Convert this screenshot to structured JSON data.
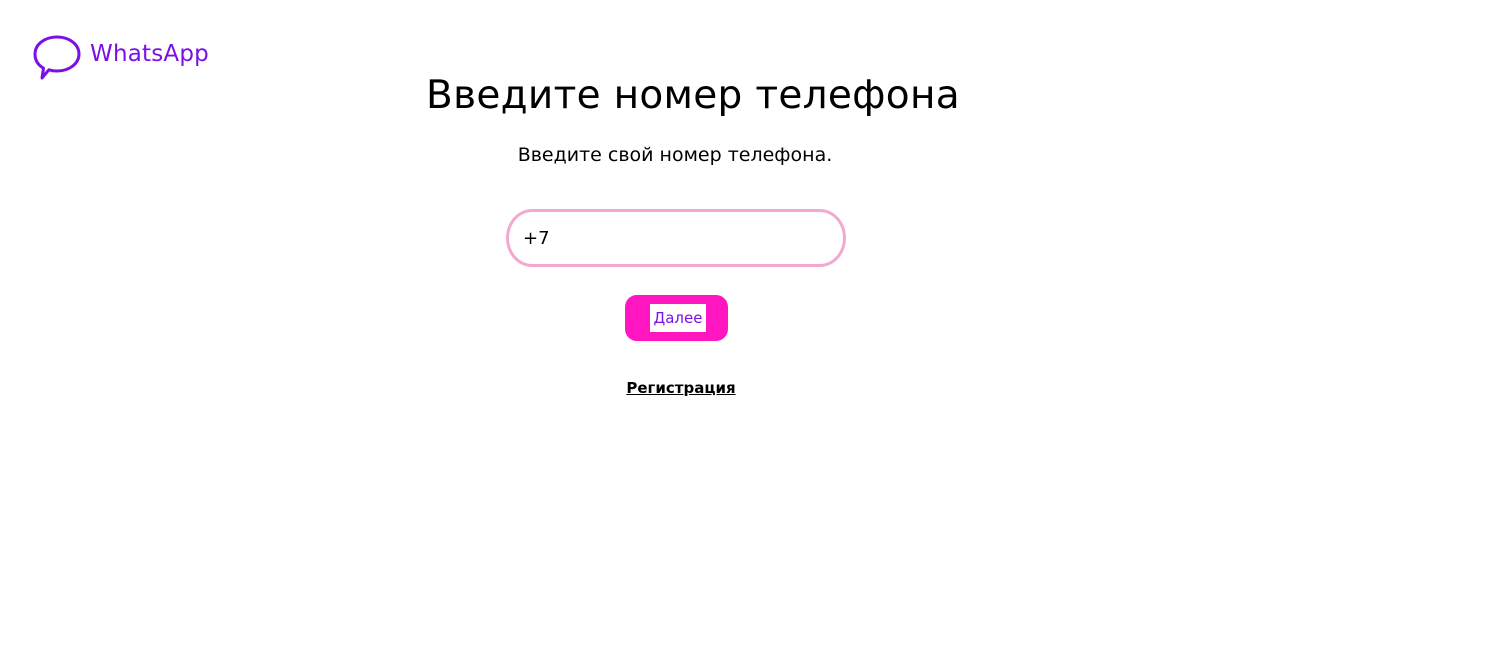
{
  "brand": {
    "name": "WhatsApp",
    "icon": "chat-bubble-icon",
    "color": "#7a10e6"
  },
  "page": {
    "title": "Введите номер телефона",
    "subtitle": "Введите свой номер телефона."
  },
  "form": {
    "phone_value": "+7",
    "next_label": "Далее",
    "register_label": "Регистрация"
  },
  "colors": {
    "accent": "#ff16c0",
    "field_border": "#f3a9cf",
    "brand": "#7a10e6"
  }
}
